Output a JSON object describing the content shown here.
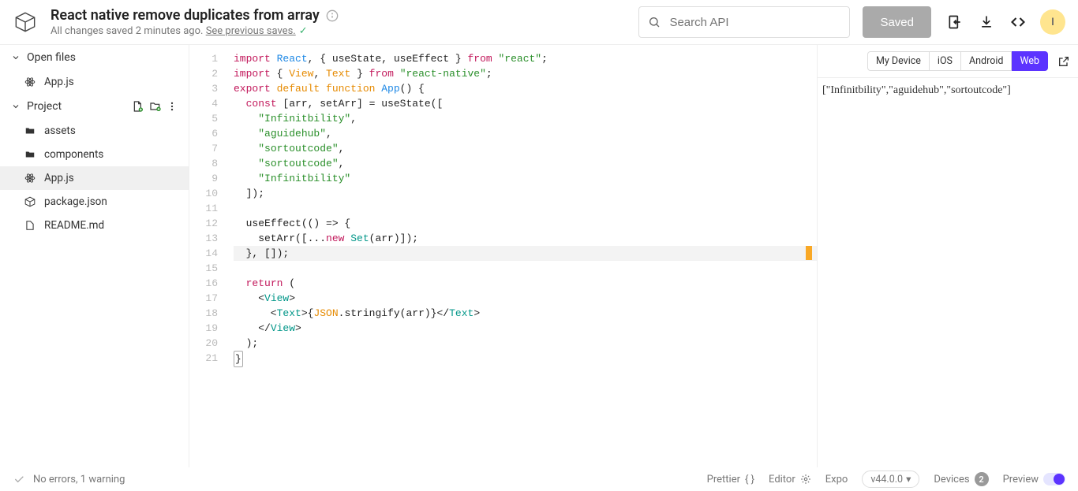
{
  "header": {
    "title": "React native remove duplicates from array",
    "status_prefix": "All changes saved 2 minutes ago. ",
    "status_link": "See previous saves.",
    "search_placeholder": "Search API",
    "saved_button": "Saved",
    "avatar_initial": "I"
  },
  "sidebar": {
    "open_files_label": "Open files",
    "open_files": [
      {
        "name": "App.js",
        "icon": "react"
      }
    ],
    "project_label": "Project",
    "project_files": [
      {
        "name": "assets",
        "icon": "folder"
      },
      {
        "name": "components",
        "icon": "folder"
      },
      {
        "name": "App.js",
        "icon": "react",
        "active": true
      },
      {
        "name": "package.json",
        "icon": "package"
      },
      {
        "name": "README.md",
        "icon": "md"
      }
    ]
  },
  "editor": {
    "line_count": 21,
    "highlight_line": 14,
    "code_tokens": [
      [
        [
          "import ",
          "red"
        ],
        [
          "React",
          "blue"
        ],
        [
          ", { useState, useEffect } ",
          "black"
        ],
        [
          "from ",
          "red"
        ],
        [
          "\"react\"",
          "green"
        ],
        [
          ";",
          "black"
        ]
      ],
      [
        [
          "import ",
          "red"
        ],
        [
          "{ ",
          "black"
        ],
        [
          "View",
          "orange"
        ],
        [
          ", ",
          "black"
        ],
        [
          "Text",
          "orange"
        ],
        [
          " } ",
          "black"
        ],
        [
          "from ",
          "red"
        ],
        [
          "\"react-native\"",
          "green"
        ],
        [
          ";",
          "black"
        ]
      ],
      [
        [
          "export ",
          "red"
        ],
        [
          "default ",
          "orange"
        ],
        [
          "function ",
          "orange"
        ],
        [
          "App",
          "blue"
        ],
        [
          "() {",
          "black"
        ]
      ],
      [
        [
          "  ",
          "black"
        ],
        [
          "const ",
          "red"
        ],
        [
          "[arr, setArr] = useState([",
          "black"
        ]
      ],
      [
        [
          "    ",
          "black"
        ],
        [
          "\"Infinitbility\"",
          "green"
        ],
        [
          ",",
          "black"
        ]
      ],
      [
        [
          "    ",
          "black"
        ],
        [
          "\"aguidehub\"",
          "green"
        ],
        [
          ",",
          "black"
        ]
      ],
      [
        [
          "    ",
          "black"
        ],
        [
          "\"sortoutcode\"",
          "green"
        ],
        [
          ",",
          "black"
        ]
      ],
      [
        [
          "    ",
          "black"
        ],
        [
          "\"sortoutcode\"",
          "green"
        ],
        [
          ",",
          "black"
        ]
      ],
      [
        [
          "    ",
          "black"
        ],
        [
          "\"Infinitbility\"",
          "green"
        ]
      ],
      [
        [
          "  ]);",
          "black"
        ]
      ],
      [],
      [
        [
          "  useEffect(() => {",
          "black"
        ]
      ],
      [
        [
          "    setArr([...",
          "black"
        ],
        [
          "new ",
          "red"
        ],
        [
          "Set",
          "teal"
        ],
        [
          "(arr)]);",
          "black"
        ]
      ],
      [
        [
          "  }, []);",
          "black"
        ]
      ],
      [],
      [
        [
          "  ",
          "black"
        ],
        [
          "return ",
          "red"
        ],
        [
          "(",
          "black"
        ]
      ],
      [
        [
          "    <",
          "black"
        ],
        [
          "View",
          "teal"
        ],
        [
          ">",
          "black"
        ]
      ],
      [
        [
          "      <",
          "black"
        ],
        [
          "Text",
          "teal"
        ],
        [
          ">{",
          "black"
        ],
        [
          "JSON",
          "orange"
        ],
        [
          ".stringify(arr)}</",
          "black"
        ],
        [
          "Text",
          "teal"
        ],
        [
          ">",
          "black"
        ]
      ],
      [
        [
          "    </",
          "black"
        ],
        [
          "View",
          "teal"
        ],
        [
          ">",
          "black"
        ]
      ],
      [
        [
          "  );",
          "black"
        ]
      ],
      [
        [
          "}",
          "black"
        ]
      ]
    ]
  },
  "preview": {
    "tabs": [
      "My Device",
      "iOS",
      "Android",
      "Web"
    ],
    "active_tab": "Web",
    "output": "[\"Infinitbility\",\"aguidehub\",\"sortoutcode\"]"
  },
  "statusbar": {
    "lint": "No errors, 1 warning",
    "prettier": "Prettier",
    "editor_label": "Editor",
    "expo": "Expo",
    "version": "v44.0.0",
    "devices_label": "Devices",
    "devices_count": "2",
    "preview_label": "Preview"
  }
}
